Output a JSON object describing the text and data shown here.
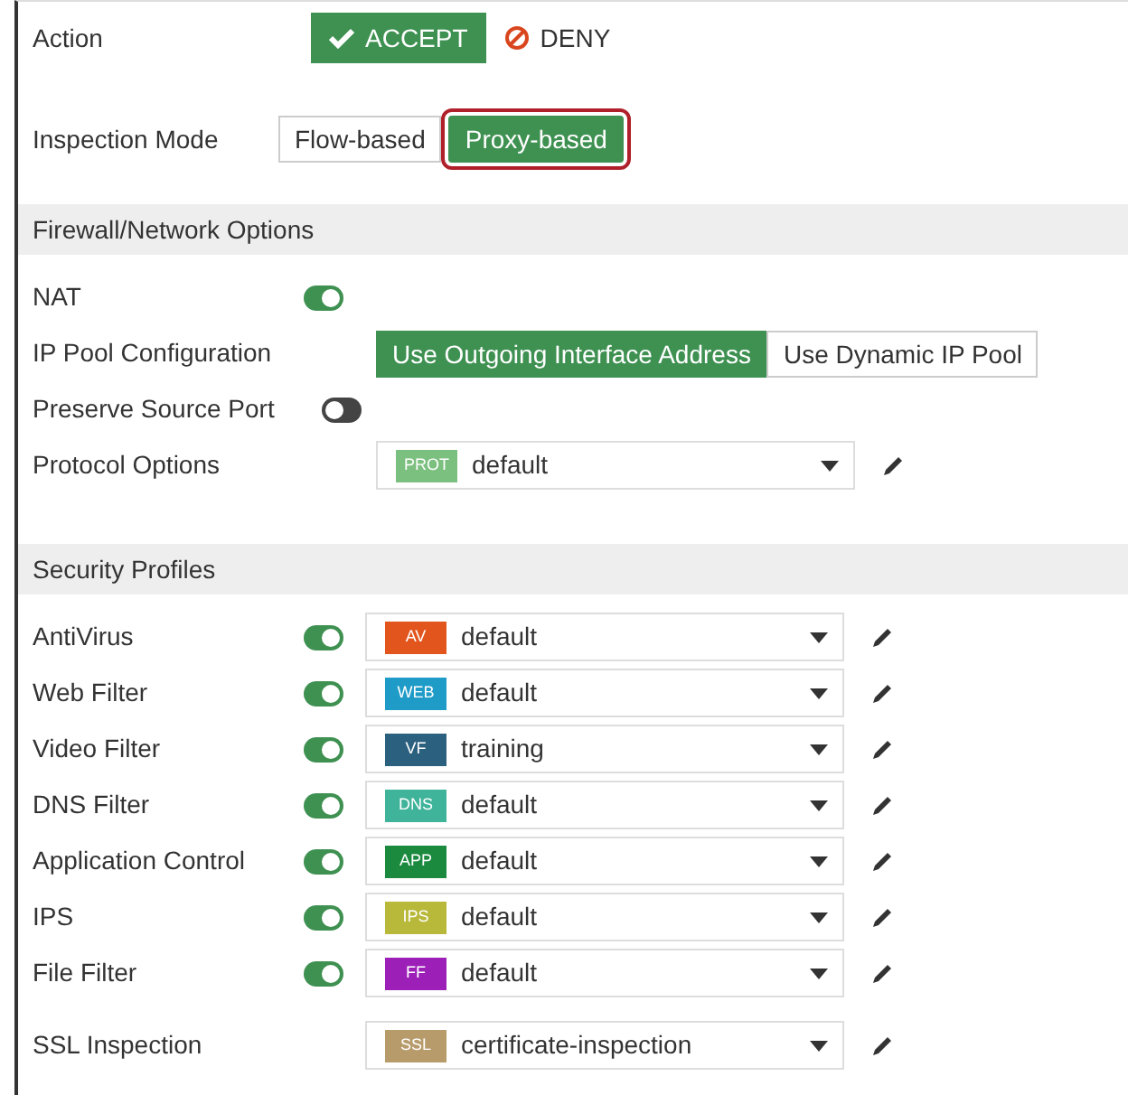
{
  "action": {
    "label": "Action",
    "options": [
      {
        "label": "ACCEPT",
        "kind": "accept",
        "selected": true
      },
      {
        "label": "DENY",
        "kind": "deny",
        "selected": false
      }
    ]
  },
  "inspection_mode": {
    "label": "Inspection Mode",
    "options": [
      {
        "label": "Flow-based",
        "selected": false,
        "highlighted": false
      },
      {
        "label": "Proxy-based",
        "selected": true,
        "highlighted": true
      }
    ]
  },
  "firewall_network_options": {
    "title": "Firewall/Network Options",
    "nat": {
      "label": "NAT",
      "on": true
    },
    "ip_pool": {
      "label": "IP Pool Configuration",
      "options": [
        {
          "label": "Use Outgoing Interface Address",
          "selected": true
        },
        {
          "label": "Use Dynamic IP Pool",
          "selected": false
        }
      ]
    },
    "preserve_source_port": {
      "label": "Preserve Source Port",
      "on": false
    },
    "protocol_options": {
      "label": "Protocol Options",
      "tag": "PROT",
      "color": "#7cc07f",
      "value": "default"
    }
  },
  "security_profiles": {
    "title": "Security Profiles",
    "items": [
      {
        "label": "AntiVirus",
        "on": true,
        "tag": "AV",
        "color": "#e2561d",
        "value": "default"
      },
      {
        "label": "Web Filter",
        "on": true,
        "tag": "WEB",
        "color": "#1f9bc8",
        "value": "default"
      },
      {
        "label": "Video Filter",
        "on": true,
        "tag": "VF",
        "color": "#2c607f",
        "value": "training"
      },
      {
        "label": "DNS Filter",
        "on": true,
        "tag": "DNS",
        "color": "#40b39b",
        "value": "default"
      },
      {
        "label": "Application Control",
        "on": true,
        "tag": "APP",
        "color": "#1b8a3f",
        "value": "default"
      },
      {
        "label": "IPS",
        "on": true,
        "tag": "IPS",
        "color": "#b8b93b",
        "value": "default"
      },
      {
        "label": "File Filter",
        "on": true,
        "tag": "FF",
        "color": "#9c20b8",
        "value": "default"
      }
    ],
    "ssl_inspection": {
      "label": "SSL Inspection",
      "tag": "SSL",
      "color": "#b89b6b",
      "value": "certificate-inspection"
    }
  }
}
